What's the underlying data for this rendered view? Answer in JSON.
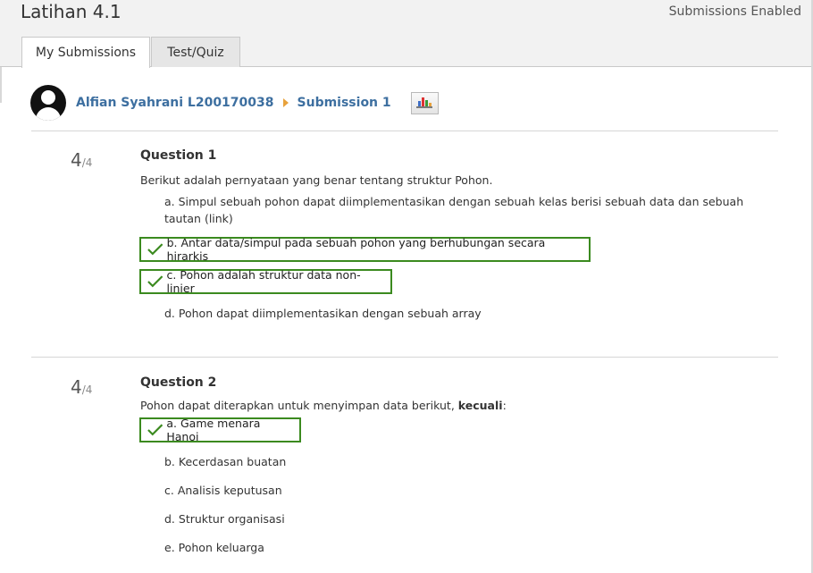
{
  "page": {
    "title": "Latihan 4.1",
    "status": "Submissions Enabled"
  },
  "tabs": [
    {
      "label": "My Submissions",
      "active": true
    },
    {
      "label": "Test/Quiz",
      "active": false
    }
  ],
  "submission": {
    "user": "Alfian Syahrani L200170038",
    "submission_label": "Submission 1",
    "chart_icon": "bar-chart-icon"
  },
  "questions": [
    {
      "score": "4",
      "out_of": "/4",
      "title": "Question 1",
      "text": "Berikut adalah pernyataan yang benar tentang struktur Pohon.",
      "options": [
        {
          "text": "a. Simpul sebuah pohon dapat diimplementasikan dengan sebuah kelas berisi sebuah data dan sebuah tautan (link)",
          "correct": false
        },
        {
          "text": "b. Antar data/simpul pada sebuah pohon yang berhubungan secara hirarkis",
          "correct": true
        },
        {
          "text": "c. Pohon adalah struktur data non-linier",
          "correct": true
        },
        {
          "text": "d. Pohon dapat diimplementasikan dengan sebuah array",
          "correct": false
        }
      ]
    },
    {
      "score": "4",
      "out_of": "/4",
      "title": "Question 2",
      "text_prefix": "Pohon dapat diterapkan untuk menyimpan data berikut,",
      "text_bold": "kecuali",
      "text_suffix": ":",
      "options": [
        {
          "text": "a. Game menara Hanoi",
          "correct": true
        },
        {
          "text": "b. Kecerdasan buatan",
          "correct": false
        },
        {
          "text": "c. Analisis keputusan",
          "correct": false
        },
        {
          "text": "d. Struktur organisasi",
          "correct": false
        },
        {
          "text": "e. Pohon keluarga",
          "correct": false
        }
      ]
    }
  ],
  "colors": {
    "link": "#3d6fa0",
    "correct_border": "#3b8a1f",
    "breadcrumb_arrow": "#e8a23c"
  }
}
